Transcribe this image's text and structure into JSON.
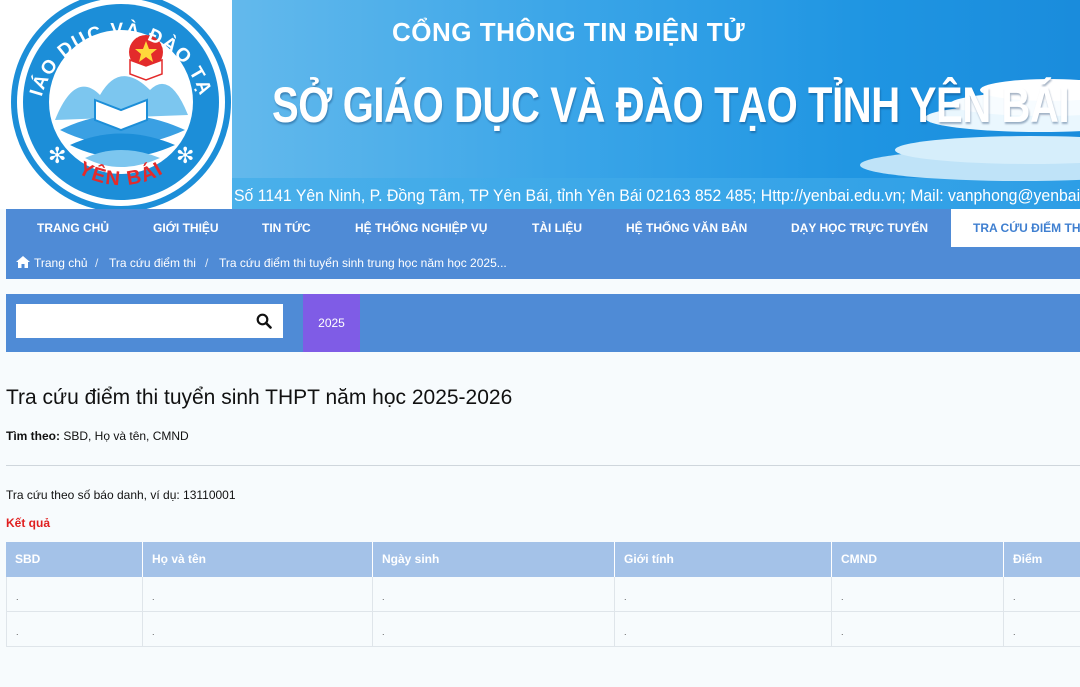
{
  "banner": {
    "logo_top_text": "GIÁO DỤC VÀ ĐÀO TẠO",
    "logo_bottom_text": "YÊN BÁI",
    "subtitle": "CỔNG THÔNG TIN ĐIỆN TỬ",
    "title": "SỞ GIÁO DỤC VÀ ĐÀO TẠO TỈNH YÊN BÁI",
    "contact": "Số 1141 Yên Ninh, P. Đồng Tâm, TP Yên Bái, tỉnh Yên Bái  02163 852 485; Http://yenbai.edu.vn; Mail: vanphong@yenbai.edu.vn"
  },
  "nav": {
    "items": [
      {
        "label": "TRANG CHỦ"
      },
      {
        "label": "GIỚI THIỆU"
      },
      {
        "label": "TIN TỨC"
      },
      {
        "label": "HỆ THỐNG NGHIỆP VỤ"
      },
      {
        "label": "TÀI LIỆU"
      },
      {
        "label": "HỆ THỐNG VĂN BẢN"
      },
      {
        "label": "DẠY HỌC TRỰC TUYẾN"
      },
      {
        "label": "TRA CỨU ĐIỂM THI"
      }
    ],
    "active_index": 7
  },
  "breadcrumb": {
    "items": [
      "Trang chủ",
      "Tra cứu điểm thi",
      "Tra cứu điểm thi tuyển sinh trung học năm học 2025..."
    ],
    "separator": "/"
  },
  "search": {
    "value": "",
    "placeholder": "",
    "icon": "search-icon",
    "year_tab": "2025"
  },
  "content": {
    "title": "Tra cứu điểm thi tuyển sinh THPT năm học 2025-2026",
    "search_by_label": "Tìm theo:",
    "search_by_value": " SBD, Họ và tên, CMND",
    "hint": "Tra cứu theo số báo danh, ví dụ: 13110001",
    "result_label": "Kết quả"
  },
  "table": {
    "columns": [
      "SBD",
      "Họ và tên",
      "Ngày sinh",
      "Giới tính",
      "CMND",
      "Điểm"
    ],
    "rows": [
      [
        ".",
        ".",
        ".",
        ".",
        ".",
        "."
      ],
      [
        ".",
        ".",
        ".",
        ".",
        ".",
        "."
      ]
    ]
  },
  "colors": {
    "nav": "#4f8bd6",
    "year_tab": "#7f5ce6",
    "table_header": "#a4c2e8",
    "result_label": "#e01f1f"
  }
}
